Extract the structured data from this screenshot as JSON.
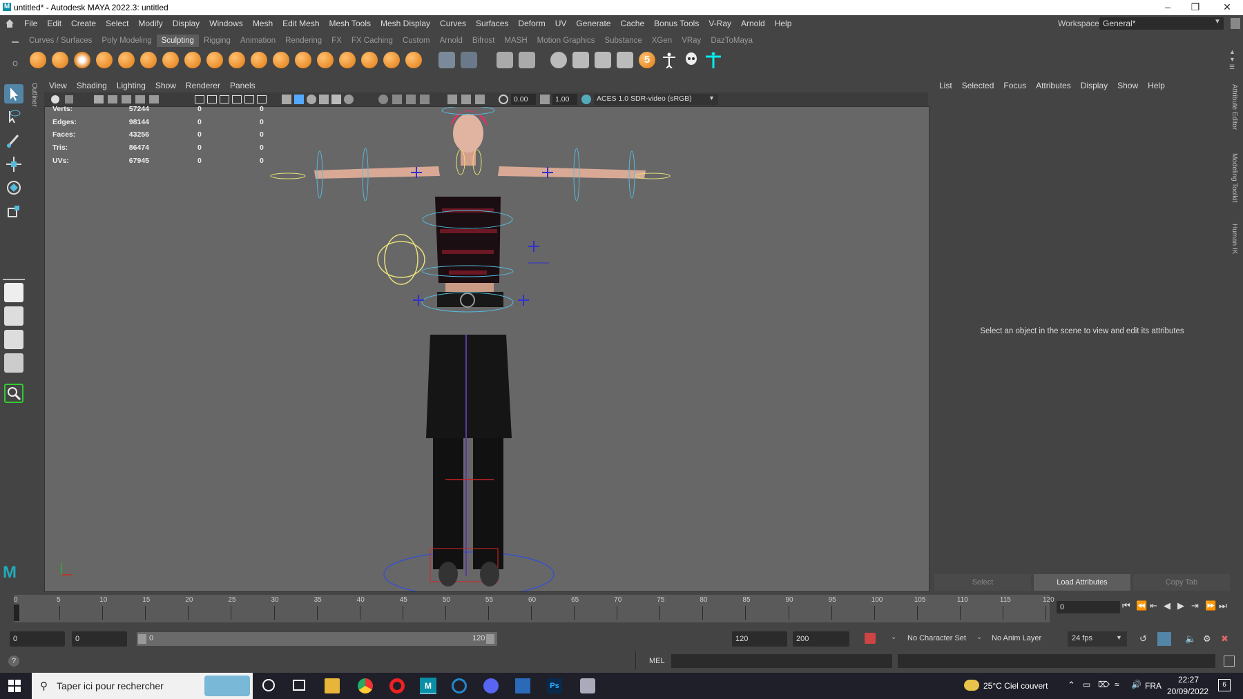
{
  "window": {
    "title": "untitled* - Autodesk MAYA 2022.3: untitled"
  },
  "menubar": {
    "items": [
      "File",
      "Edit",
      "Create",
      "Select",
      "Modify",
      "Display",
      "Windows",
      "Mesh",
      "Edit Mesh",
      "Mesh Tools",
      "Mesh Display",
      "Curves",
      "Surfaces",
      "Deform",
      "UV",
      "Generate",
      "Cache",
      "Bonus Tools",
      "V-Ray",
      "Arnold",
      "Help"
    ],
    "workspace_label": "Workspace:",
    "workspace_value": "General*"
  },
  "shelf": {
    "tabs": [
      "Curves / Surfaces",
      "Poly Modeling",
      "Sculpting",
      "Rigging",
      "Animation",
      "Rendering",
      "FX",
      "FX Caching",
      "Custom",
      "Arnold",
      "Bifrost",
      "MASH",
      "Motion Graphics",
      "Substance",
      "XGen",
      "VRay",
      "DazToMaya"
    ],
    "active_tab": "Sculpting",
    "badge_number": "5"
  },
  "viewport": {
    "menu": [
      "View",
      "Shading",
      "Lighting",
      "Show",
      "Renderer",
      "Panels"
    ],
    "toolbar": {
      "exposure": "0.00",
      "gamma": "1.00",
      "color_space": "ACES 1.0 SDR-video (sRGB)"
    },
    "hud": [
      {
        "label": "Verts:",
        "v1": "57244",
        "v2": "0",
        "v3": "0"
      },
      {
        "label": "Edges:",
        "v1": "98144",
        "v2": "0",
        "v3": "0"
      },
      {
        "label": "Faces:",
        "v1": "43256",
        "v2": "0",
        "v3": "0"
      },
      {
        "label": "Tris:",
        "v1": "86474",
        "v2": "0",
        "v3": "0"
      },
      {
        "label": "UVs:",
        "v1": "67945",
        "v2": "0",
        "v3": "0"
      }
    ],
    "outliner_tab": "Outliner"
  },
  "attribute_editor": {
    "menu": [
      "List",
      "Selected",
      "Focus",
      "Attributes",
      "Display",
      "Show",
      "Help"
    ],
    "message": "Select an object in the scene to view and edit its attributes",
    "buttons": {
      "select": "Select",
      "load": "Load Attributes",
      "copy": "Copy Tab"
    },
    "side_tabs": [
      "Attribute Editor",
      "Modeling Toolkit",
      "Human IK"
    ]
  },
  "timeline": {
    "ticks": [
      "0",
      "5",
      "10",
      "15",
      "20",
      "25",
      "30",
      "35",
      "40",
      "45",
      "50",
      "55",
      "60",
      "65",
      "70",
      "75",
      "80",
      "85",
      "90",
      "95",
      "100",
      "105",
      "110",
      "115",
      "120"
    ],
    "current_frame": "0",
    "range_start": "0",
    "range_start2": "0",
    "slider_start": "0",
    "slider_end": "120",
    "end_frame": "120",
    "max_frame": "200",
    "character_set": "No Character Set",
    "anim_layer": "No Anim Layer",
    "fps": "24 fps"
  },
  "commandline": {
    "lang": "MEL"
  },
  "taskbar": {
    "search_placeholder": "Taper ici pour rechercher",
    "weather": "25°C Ciel couvert",
    "lang": "FRA",
    "time": "22:27",
    "date": "20/09/2022",
    "notifications": "6"
  }
}
